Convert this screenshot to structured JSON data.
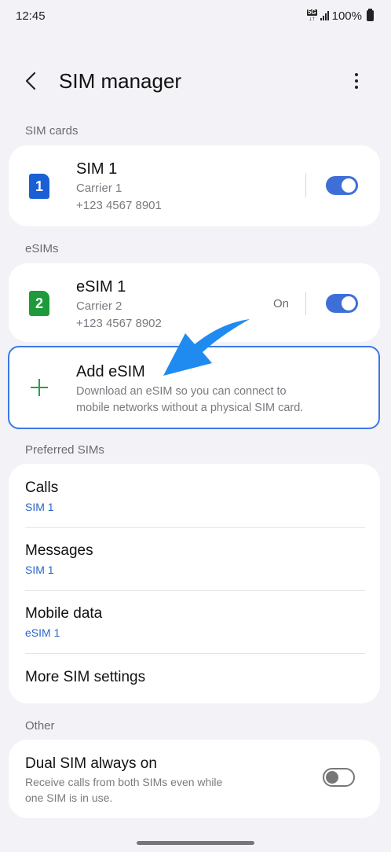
{
  "status_bar": {
    "time": "12:45",
    "network": "5G",
    "network_sub": "↓↑",
    "battery": "100%"
  },
  "header": {
    "title": "SIM manager"
  },
  "sections": {
    "sim_cards": "SIM cards",
    "esims": "eSIMs",
    "preferred": "Preferred SIMs",
    "other": "Other"
  },
  "sim1": {
    "icon_number": "1",
    "name": "SIM 1",
    "carrier": "Carrier 1",
    "number": "+123 4567 8901",
    "enabled": true,
    "icon_color": "#1a5fd6"
  },
  "esim1": {
    "icon_number": "2",
    "name": "eSIM 1",
    "carrier": "Carrier 2",
    "number": "+123 4567 8902",
    "status": "On",
    "enabled": true,
    "icon_color": "#1e9a3a"
  },
  "add_esim": {
    "title": "Add eSIM",
    "description_line1": "Download an eSIM so you can connect to",
    "description_line2": "mobile networks without a physical SIM card."
  },
  "preferred": {
    "calls": {
      "label": "Calls",
      "value": "SIM 1"
    },
    "messages": {
      "label": "Messages",
      "value": "SIM 1"
    },
    "mobile_data": {
      "label": "Mobile data",
      "value": "eSIM 1"
    },
    "more": {
      "label": "More SIM settings"
    }
  },
  "dual_sim": {
    "title": "Dual SIM always on",
    "description_line1": "Receive calls from both SIMs even while",
    "description_line2": "one SIM is in use.",
    "enabled": false
  },
  "colors": {
    "accent": "#3e6fd8",
    "link": "#2b66c8",
    "annotation_arrow": "#1f8bf0"
  },
  "icons": {
    "back": "back-arrow-icon",
    "more": "more-vert-icon",
    "add": "plus-icon"
  }
}
